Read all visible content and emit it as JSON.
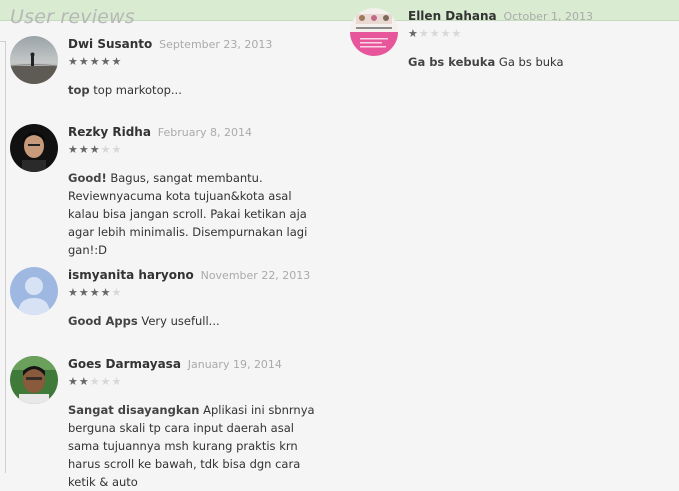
{
  "section_title": "User reviews",
  "reviews_left": [
    {
      "author": "Dwi Susanto",
      "date": "September 23, 2013",
      "rating": 5,
      "title": "top",
      "text": "top markotop..."
    },
    {
      "author": "Rezky Ridha",
      "date": "February 8, 2014",
      "rating": 3,
      "title": "Good!",
      "text": "Bagus, sangat membantu. Reviewnyacuma kota tujuan&kota asal kalau bisa jangan scroll. Pakai ketikan aja agar lebih minimalis. Disempurnakan lagi gan!:D"
    },
    {
      "author": "ismyanita haryono",
      "date": "November 22, 2013",
      "rating": 4,
      "title": "Good Apps",
      "text": "Very usefull..."
    },
    {
      "author": "Goes Darmayasa",
      "date": "January 19, 2014",
      "rating": 2,
      "title": "Sangat disayangkan",
      "text": "Aplikasi ini sbnrnya berguna skali tp cara input daerah asal sama tujuannya msh kurang praktis krn harus scroll ke bawah, tdk bisa dgn cara ketik & auto"
    }
  ],
  "reviews_right": [
    {
      "author": "Ellen Dahana",
      "date": "October 1, 2013",
      "rating": 1,
      "title": "Ga bs kebuka",
      "text": "Ga bs buka"
    }
  ],
  "avatars": {
    "dwi": "beach-silhouette-photo",
    "rezky": "portrait-photo",
    "ismyanita": "default-person-icon",
    "goes": "portrait-photo",
    "ellen": "pink-collage-photo"
  }
}
